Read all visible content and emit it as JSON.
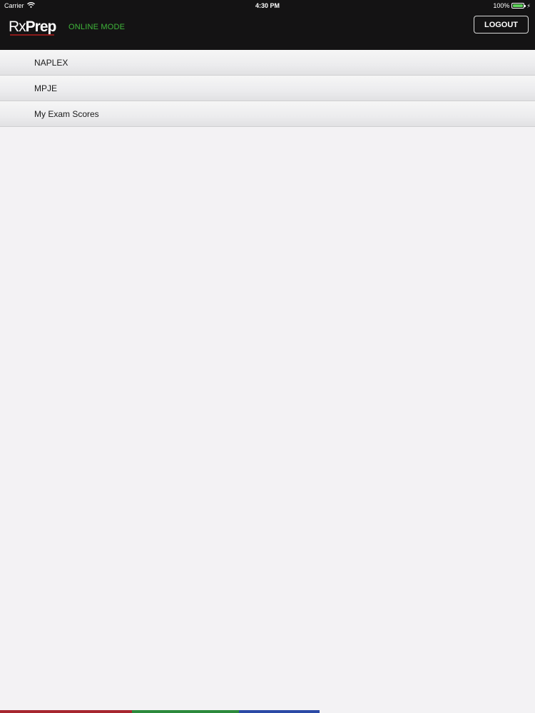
{
  "status_bar": {
    "carrier": "Carrier",
    "time": "4:30 PM",
    "battery": "100%",
    "battery_level": 1.0
  },
  "header": {
    "logo_rx": "Rx",
    "logo_prep": "Prep",
    "mode": "ONLINE MODE",
    "logout_label": "LOGOUT"
  },
  "menu": {
    "items": [
      {
        "label": "NAPLEX"
      },
      {
        "label": "MPJE"
      },
      {
        "label": "My Exam Scores"
      }
    ]
  },
  "colors": {
    "header_bg": "#141314",
    "mode_green": "#3fb63a",
    "page_bg": "#f3f2f4",
    "bar_red": "#a7262f",
    "bar_green": "#2c8a3c",
    "bar_blue": "#2b4aa6"
  },
  "icons": [
    "wifi-icon",
    "battery-icon",
    "charging-icon"
  ]
}
